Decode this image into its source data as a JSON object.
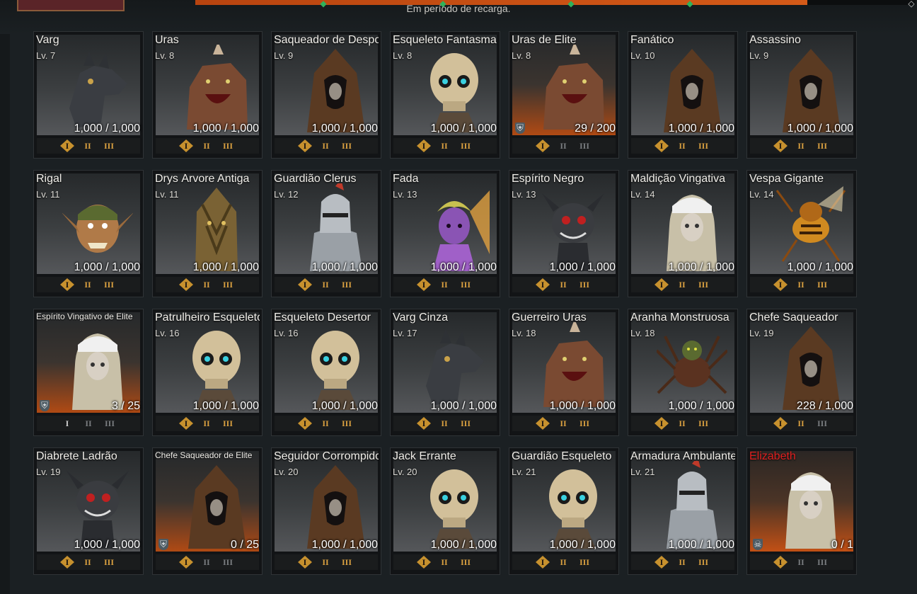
{
  "header": {
    "recharge_text": "Em período de recarga.",
    "progress_fraction": 0.85
  },
  "tier_labels": [
    "I",
    "II",
    "III"
  ],
  "colors": {
    "accent": "#c7912e",
    "progress": "#d45a18",
    "boss_name": "#e02020",
    "marker": "#2fb25a"
  },
  "monsters": [
    {
      "name": "Varg",
      "level": "Lv. 7",
      "count": "1,000 / 1,000",
      "kind": "normal",
      "tiers": [
        true,
        true,
        true
      ],
      "icon": "wolf"
    },
    {
      "name": "Uras",
      "level": "Lv. 8",
      "count": "1,000 / 1,000",
      "kind": "normal",
      "tiers": [
        true,
        true,
        true
      ],
      "icon": "beast"
    },
    {
      "name": "Saqueador de Despojos",
      "level": "Lv. 9",
      "count": "1,000 / 1,000",
      "kind": "normal",
      "tiers": [
        true,
        true,
        true
      ],
      "icon": "hooded"
    },
    {
      "name": "Esqueleto Fantasma",
      "level": "Lv. 8",
      "count": "1,000 / 1,000",
      "kind": "normal",
      "tiers": [
        true,
        true,
        true
      ],
      "icon": "skull"
    },
    {
      "name": "Uras de Elite",
      "level": "Lv. 8",
      "count": "29 / 200",
      "kind": "elite",
      "tiers": [
        true,
        false,
        false
      ],
      "icon": "beast"
    },
    {
      "name": "Fanático",
      "level": "Lv. 10",
      "count": "1,000 / 1,000",
      "kind": "normal",
      "tiers": [
        true,
        true,
        true
      ],
      "icon": "hooded"
    },
    {
      "name": "Assassino",
      "level": "Lv. 9",
      "count": "1,000 / 1,000",
      "kind": "normal",
      "tiers": [
        true,
        true,
        true
      ],
      "icon": "hooded"
    },
    {
      "name": "Rigal",
      "level": "Lv. 11",
      "count": "1,000 / 1,000",
      "kind": "normal",
      "tiers": [
        true,
        true,
        true
      ],
      "icon": "goblin"
    },
    {
      "name": "Drys Árvore Antiga",
      "level": "Lv. 11",
      "count": "1,000 / 1,000",
      "kind": "normal",
      "tiers": [
        true,
        true,
        true
      ],
      "icon": "tree"
    },
    {
      "name": "Guardião Clerus",
      "level": "Lv. 12",
      "count": "1,000 / 1,000",
      "kind": "normal",
      "tiers": [
        true,
        true,
        true
      ],
      "icon": "knight"
    },
    {
      "name": "Fada",
      "level": "Lv. 13",
      "count": "1,000 / 1,000",
      "kind": "normal",
      "tiers": [
        true,
        true,
        true
      ],
      "icon": "fairy"
    },
    {
      "name": "Espírito Negro",
      "level": "Lv. 13",
      "count": "1,000 / 1,000",
      "kind": "normal",
      "tiers": [
        true,
        true,
        true
      ],
      "icon": "imp"
    },
    {
      "name": "Maldição Vingativa",
      "level": "Lv. 14",
      "count": "1,000 / 1,000",
      "kind": "normal",
      "tiers": [
        true,
        true,
        true
      ],
      "icon": "ghost"
    },
    {
      "name": "Vespa Gigante",
      "level": "Lv. 14",
      "count": "1,000 / 1,000",
      "kind": "normal",
      "tiers": [
        true,
        true,
        true
      ],
      "icon": "wasp"
    },
    {
      "name": "Espírito Vingativo de Elite",
      "level": "",
      "count": "3 / 25",
      "kind": "elite",
      "tiers": [
        false,
        false,
        false
      ],
      "icon": "ghost"
    },
    {
      "name": "Patrulheiro Esqueleto",
      "level": "Lv. 16",
      "count": "1,000 / 1,000",
      "kind": "normal",
      "tiers": [
        true,
        true,
        true
      ],
      "icon": "skull"
    },
    {
      "name": "Esqueleto Desertor",
      "level": "Lv. 16",
      "count": "1,000 / 1,000",
      "kind": "normal",
      "tiers": [
        true,
        true,
        true
      ],
      "icon": "skull"
    },
    {
      "name": "Varg Cinza",
      "level": "Lv. 17",
      "count": "1,000 / 1,000",
      "kind": "normal",
      "tiers": [
        true,
        true,
        true
      ],
      "icon": "wolf"
    },
    {
      "name": "Guerreiro Uras",
      "level": "Lv. 18",
      "count": "1,000 / 1,000",
      "kind": "normal",
      "tiers": [
        true,
        true,
        true
      ],
      "icon": "beast"
    },
    {
      "name": "Aranha Monstruosa",
      "level": "Lv. 18",
      "count": "1,000 / 1,000",
      "kind": "normal",
      "tiers": [
        true,
        true,
        true
      ],
      "icon": "spider"
    },
    {
      "name": "Chefe Saqueador",
      "level": "Lv. 19",
      "count": "228 / 1,000",
      "kind": "normal",
      "tiers": [
        true,
        true,
        false
      ],
      "icon": "hooded"
    },
    {
      "name": "Diabrete Ladrão",
      "level": "Lv. 19",
      "count": "1,000 / 1,000",
      "kind": "normal",
      "tiers": [
        true,
        true,
        true
      ],
      "icon": "imp"
    },
    {
      "name": "Chefe Saqueador de Elite",
      "level": "",
      "count": "0 / 25",
      "kind": "elite",
      "tiers": [
        true,
        false,
        false
      ],
      "icon": "hooded"
    },
    {
      "name": "Seguidor Corrompido",
      "level": "Lv. 20",
      "count": "1,000 / 1,000",
      "kind": "normal",
      "tiers": [
        true,
        true,
        true
      ],
      "icon": "hooded"
    },
    {
      "name": "Jack Errante",
      "level": "Lv. 20",
      "count": "1,000 / 1,000",
      "kind": "normal",
      "tiers": [
        true,
        true,
        true
      ],
      "icon": "skull"
    },
    {
      "name": "Guardião Esqueleto",
      "level": "Lv. 21",
      "count": "1,000 / 1,000",
      "kind": "normal",
      "tiers": [
        true,
        true,
        true
      ],
      "icon": "skull"
    },
    {
      "name": "Armadura Ambulante",
      "level": "Lv. 21",
      "count": "1,000 / 1,000",
      "kind": "normal",
      "tiers": [
        true,
        true,
        true
      ],
      "icon": "knight"
    },
    {
      "name": "Elizabeth",
      "level": "",
      "count": "0 / 1",
      "kind": "boss",
      "tiers": [
        true,
        false,
        false
      ],
      "icon": "ghost"
    }
  ]
}
